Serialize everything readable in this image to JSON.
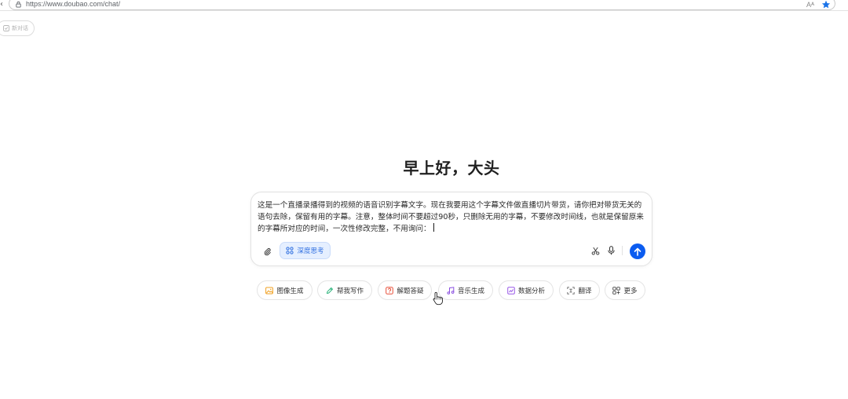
{
  "browser": {
    "url": "https://www.doubao.com/chat/",
    "read_aloud": "Aᴬ"
  },
  "sidebar": {
    "new_chat_label": "新对话"
  },
  "main": {
    "greeting": "早上好，大头",
    "composer": {
      "text": "这是一个直播录播得到的视频的语音识别字幕文字。现在我要用这个字幕文件做直播切片带货，请你把对带货无关的语句去除，保留有用的字幕。注意，整体时间不要超过90秒，只删除无用的字幕，不要修改时间线，也就是保留原来的字幕所对应的时间，一次性修改完整，不用询问：",
      "deep_think_label": "深度思考"
    },
    "quick_actions": [
      {
        "label": "图像生成",
        "icon": "image-icon",
        "color": "#f0a020"
      },
      {
        "label": "帮我写作",
        "icon": "pen-icon",
        "color": "#2ab37a"
      },
      {
        "label": "解题答疑",
        "icon": "question-icon",
        "color": "#e8503a"
      },
      {
        "label": "音乐生成",
        "icon": "music-icon",
        "color": "#8a4fe0"
      },
      {
        "label": "数据分析",
        "icon": "chart-icon",
        "color": "#9a5ae8"
      },
      {
        "label": "翻译",
        "icon": "translate-icon",
        "color": "#666666"
      },
      {
        "label": "更多",
        "icon": "grid-icon",
        "color": "#444444"
      }
    ]
  },
  "colors": {
    "accent": "#0b5cf0",
    "deep_think_bg": "#e5efff",
    "star": "#1a73e8"
  }
}
